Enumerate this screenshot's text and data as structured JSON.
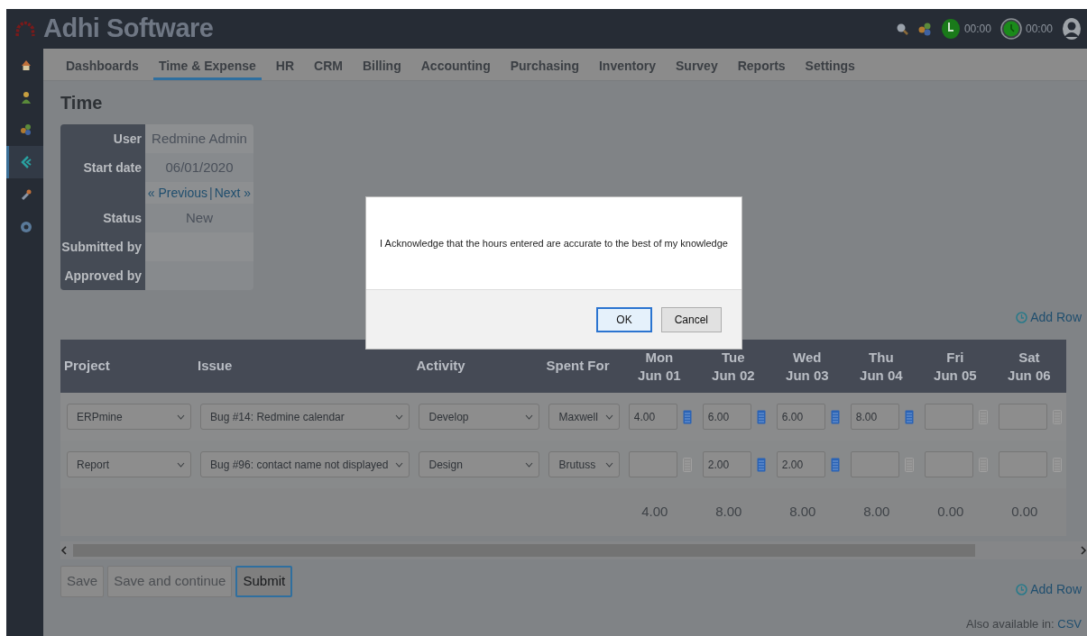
{
  "app": {
    "title": "Adhi Software",
    "timers": [
      "00:00",
      "00:00"
    ]
  },
  "sidebar": {
    "items": [
      {
        "selected": false
      },
      {
        "selected": false
      },
      {
        "selected": false
      },
      {
        "selected": true
      },
      {
        "selected": false
      },
      {
        "selected": false
      }
    ]
  },
  "nav": {
    "tabs": [
      {
        "label": "Dashboards",
        "selected": false
      },
      {
        "label": "Time & Expense",
        "selected": true
      },
      {
        "label": "HR",
        "selected": false
      },
      {
        "label": "CRM",
        "selected": false
      },
      {
        "label": "Billing",
        "selected": false
      },
      {
        "label": "Accounting",
        "selected": false
      },
      {
        "label": "Purchasing",
        "selected": false
      },
      {
        "label": "Inventory",
        "selected": false
      },
      {
        "label": "Survey",
        "selected": false
      },
      {
        "label": "Reports",
        "selected": false
      },
      {
        "label": "Settings",
        "selected": false
      }
    ]
  },
  "page": {
    "title": "Time",
    "info": [
      {
        "kind": "field",
        "label": "User",
        "value": "Redmine Admin"
      },
      {
        "kind": "field",
        "label": "Start date",
        "value": "06/01/2020"
      },
      {
        "kind": "pager",
        "links": [
          "« Previous",
          "Next »"
        ],
        "separator": "|"
      },
      {
        "kind": "field",
        "label": "Status",
        "value": "New"
      },
      {
        "kind": "field",
        "label": "Submitted by"
      },
      {
        "kind": "field",
        "label": "Approved by"
      }
    ],
    "add_row_links": [
      "Add Row",
      "Add Row"
    ]
  },
  "table": {
    "columns": [
      "Project",
      "Issue",
      "Activity",
      "Spent For"
    ],
    "days": [
      {
        "day": "Mon",
        "date": "Jun 01"
      },
      {
        "day": "Tue",
        "date": "Jun 02"
      },
      {
        "day": "Wed",
        "date": "Jun 03"
      },
      {
        "day": "Thu",
        "date": "Jun 04"
      },
      {
        "day": "Fri",
        "date": "Jun 05"
      },
      {
        "day": "Sat",
        "date": "Jun 06"
      }
    ],
    "rows": [
      {
        "project": "ERPmine",
        "issue": "Bug #14: Redmine calendar",
        "activity": "Develop",
        "spent_for": "Maxwell",
        "hours": [
          {
            "value": "4.00",
            "noted": true
          },
          {
            "value": "6.00",
            "noted": true
          },
          {
            "value": "6.00",
            "noted": true
          },
          {
            "value": "8.00",
            "noted": true
          },
          {
            "noted": false
          },
          {
            "noted": false
          }
        ]
      },
      {
        "project": "Report",
        "issue": "Bug #96: contact name not displayed",
        "activity": "Design",
        "spent_for": "Brutuss",
        "hours": [
          {
            "noted": false
          },
          {
            "value": "2.00",
            "noted": true
          },
          {
            "value": "2.00",
            "noted": true
          },
          {
            "noted": false
          },
          {
            "noted": false
          },
          {
            "noted": false
          }
        ]
      }
    ],
    "totals": [
      "4.00",
      "8.00",
      "8.00",
      "8.00",
      "0.00",
      "0.00"
    ]
  },
  "actions": [
    {
      "label": "Save",
      "focused": false
    },
    {
      "label": "Save and continue",
      "focused": false
    },
    {
      "label": "Submit",
      "focused": true
    }
  ],
  "footer": {
    "text": "Also available in:",
    "link": "CSV"
  },
  "dialog": {
    "message": "I Acknowledge that the hours entered are accurate to the best of my knowledge",
    "buttons": [
      {
        "label": "OK",
        "focused": true
      },
      {
        "label": "Cancel",
        "focused": false
      }
    ]
  }
}
